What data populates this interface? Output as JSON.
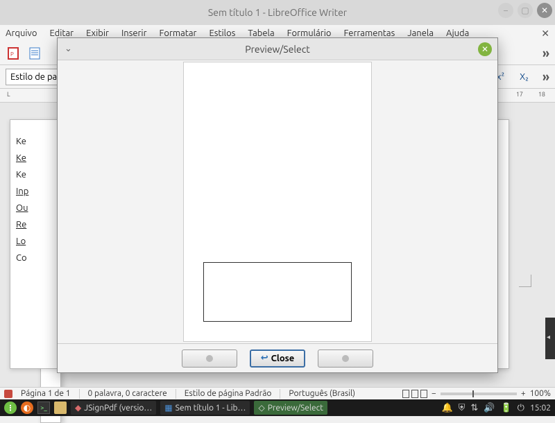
{
  "window": {
    "title": "Sem título 1 - LibreOffice Writer"
  },
  "menu": {
    "items": [
      "Arquivo",
      "Editar",
      "Exibir",
      "Inserir",
      "Formatar",
      "Estilos",
      "Tabela",
      "Formulário",
      "Ferramentas",
      "Janela",
      "Ajuda"
    ]
  },
  "toolbar2": {
    "style_label": "Estilo de pa",
    "superscript": "x²",
    "subscript": "X₂",
    "more": "»"
  },
  "ruler": {
    "left": "L",
    "r1": "17",
    "r2": "18"
  },
  "doc": {
    "lines": [
      "Ke",
      "Ke",
      "Ke",
      "Inp",
      "Ou",
      "Re",
      "Lo",
      "Co"
    ]
  },
  "dialog": {
    "title": "Preview/Select",
    "close_label": "Close"
  },
  "status": {
    "page": "Página 1 de 1",
    "words": "0 palavra, 0 caractere",
    "style": "Estilo de página Padrão",
    "lang": "Português (Brasil)",
    "zoom_minus": "−",
    "zoom_plus": "+",
    "zoom": "100%"
  },
  "taskbar": {
    "app1": "JSignPdf (versio…",
    "app2": "Sem título 1 - Lib…",
    "app3": "Preview/Select",
    "clock": "15:02"
  }
}
